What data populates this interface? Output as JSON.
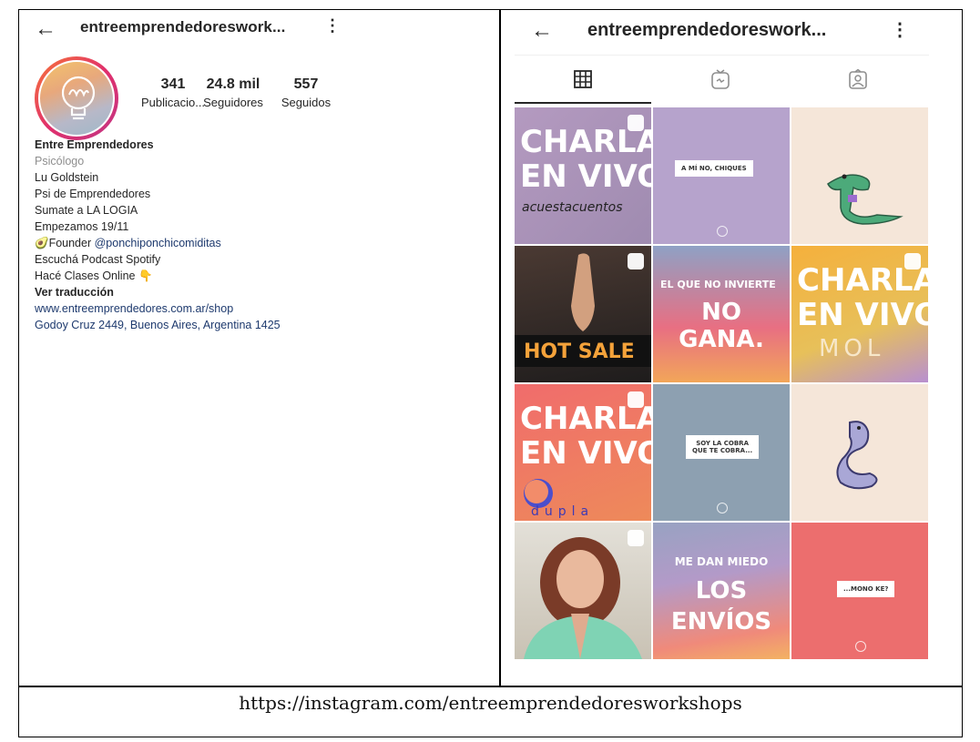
{
  "left": {
    "username": "entreemprendedoreswork...",
    "stats": [
      {
        "number": "341",
        "label": "Publicacio..."
      },
      {
        "number": "24.8 mil",
        "label": "Seguidores"
      },
      {
        "number": "557",
        "label": "Seguidos"
      }
    ],
    "bio": {
      "name": "Entre Emprendedores",
      "category": "Psicólogo",
      "lines": [
        "Lu Goldstein",
        "Psi de Emprendedores",
        "Sumate a LA LOGIA",
        "Empezamos 19/11"
      ],
      "founder_prefix": "🥑Founder ",
      "founder_mention": "@ponchiponchicomiditas",
      "podcast": "Escuchá Podcast Spotify",
      "classes": "Hacé Clases Online 👇",
      "translate": "Ver traducción",
      "website": "www.entreemprendedores.com.ar/shop",
      "address": "Godoy Cruz 2449, Buenos Aires, Argentina 1425"
    }
  },
  "right": {
    "username": "entreemprendedoreswork...",
    "tabs": [
      "grid-icon",
      "igtv-icon",
      "tagged-icon"
    ],
    "posts": {
      "p1": [
        "CHARLA",
        "EN VIVO",
        "acuestacuentos"
      ],
      "p2": "A MÍ NO, CHIQUES",
      "p4": "HOT SALE",
      "p5": [
        "EL QUE NO INVIERTE",
        "NO",
        "GANA."
      ],
      "p6": [
        "CHARLA",
        "EN VIVO",
        "MOL"
      ],
      "p7": [
        "CHARLA",
        "EN VIVO",
        "dupla"
      ],
      "p8": [
        "SOY LA COBRA",
        "QUE TE COBRA..."
      ],
      "p11": [
        "ME DAN MIEDO",
        "LOS",
        "ENVÍOS"
      ],
      "p12": "...MONO KE?"
    }
  },
  "caption": "https://instagram.com/entreemprendedoresworkshops"
}
